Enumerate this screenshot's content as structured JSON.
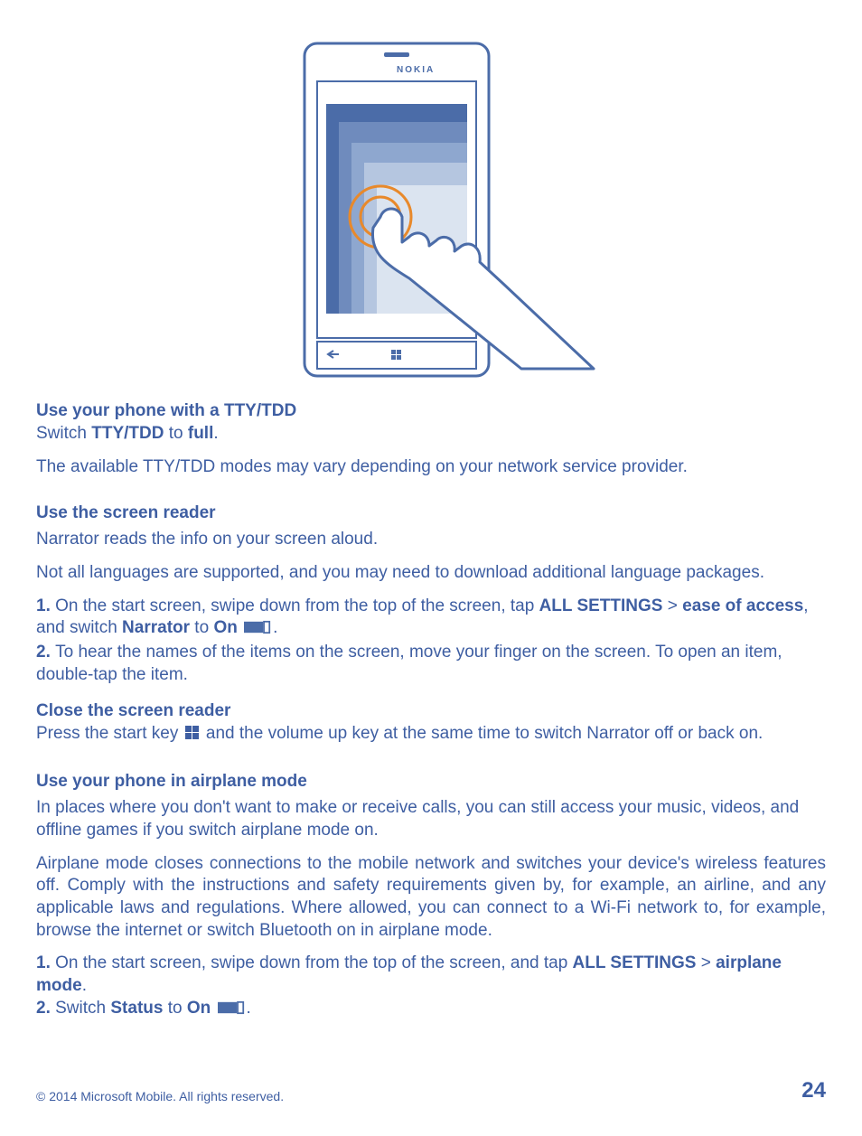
{
  "brand": "NOKIA",
  "sections": {
    "tty": {
      "heading": "Use your phone with a TTY/TDD",
      "line_switch_prefix": "Switch ",
      "line_switch_bold1": "TTY/TDD",
      "line_switch_to": " to ",
      "line_switch_bold2": "full",
      "line_switch_period": ".",
      "note": "The available TTY/TDD modes may vary depending on your network service provider."
    },
    "reader": {
      "heading": "Use the screen reader",
      "p1": "Narrator reads the info on your screen aloud.",
      "p2": "Not all languages are supported, and you may need to download additional language packages.",
      "step1": {
        "num": "1. ",
        "text1": "On the start screen, swipe down from the top of the screen, tap ",
        "allsettings": "ALL SETTINGS",
        "sep": " > ",
        "easeofaccess": "ease of access",
        "text2": ", and switch ",
        "narrator": "Narrator",
        "to": " to ",
        "on": "On",
        "period": "."
      },
      "step2": {
        "num": "2. ",
        "text": "To hear the names of the items on the screen, move your finger on the screen. To open an item, double-tap the item."
      }
    },
    "close": {
      "heading": "Close the screen reader",
      "text1": "Press the start key ",
      "text2": " and the volume up key at the same time to switch Narrator off or back on."
    },
    "airplane": {
      "heading": "Use your phone in airplane mode",
      "p1": "In places where you don't want to make or receive calls, you can still access your music, videos, and offline games if you switch airplane mode on.",
      "p2": "Airplane mode closes connections to the mobile network and switches your device's wireless features off. Comply with the instructions and safety requirements given by, for example, an airline, and any applicable laws and regulations. Where allowed, you can connect to a Wi-Fi network to, for example, browse the internet or switch Bluetooth on in airplane mode.",
      "step1": {
        "num": "1. ",
        "text1": "On the start screen, swipe down from the top of the screen, and tap ",
        "allsettings": "ALL SETTINGS",
        "sep": " > ",
        "airplanemode": "airplane mode",
        "period": "."
      },
      "step2": {
        "num": "2. ",
        "text1": "Switch ",
        "status": "Status",
        "to": " to ",
        "on": "On",
        "period": "."
      }
    }
  },
  "footer": {
    "copyright": "© 2014 Microsoft Mobile. All rights reserved.",
    "page": "24"
  }
}
